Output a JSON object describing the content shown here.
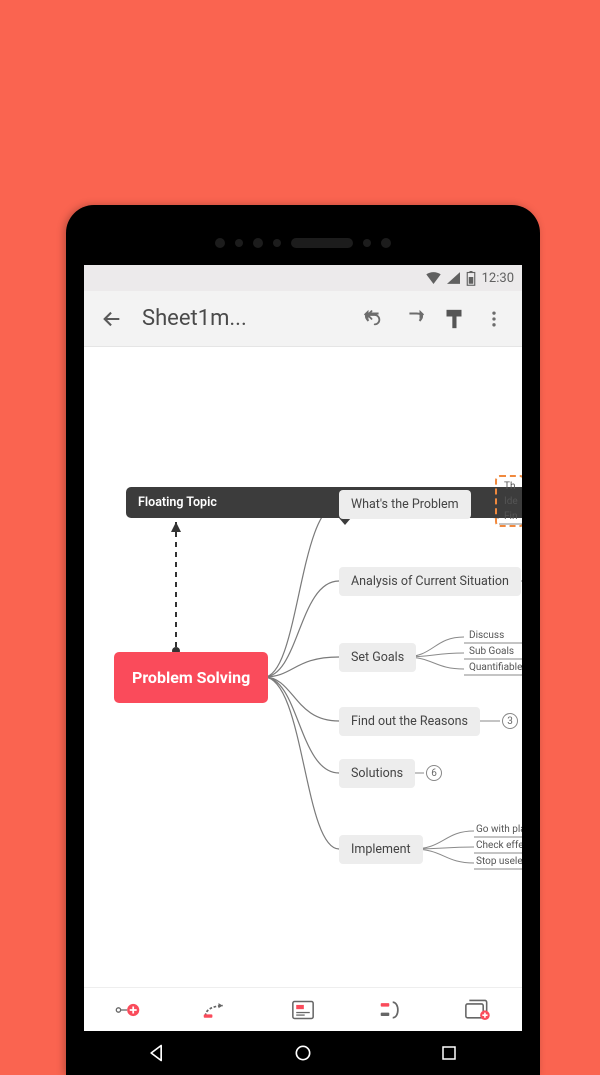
{
  "status": {
    "time": "12:30"
  },
  "toolbar": {
    "title": "Sheet1m...",
    "back": "Back",
    "undo": "Undo",
    "redo": "Redo",
    "format": "Format",
    "more": "More"
  },
  "mindmap": {
    "root": "Problem Solving",
    "floating": "Floating Topic",
    "branches": [
      {
        "label": "What's the Problem",
        "children": [
          "Th",
          "Ide",
          "Fin"
        ],
        "children_selected": true
      },
      {
        "label": "Analysis of Current Situation",
        "children": []
      },
      {
        "label": "Set Goals",
        "children": [
          "Discuss",
          "Sub Goals",
          "Quantifiable targe"
        ]
      },
      {
        "label": "Find out the Reasons",
        "collapsed_count": 3
      },
      {
        "label": "Solutions",
        "collapsed_count": 6
      },
      {
        "label": "Implement",
        "children": [
          "Go with plans",
          "Check effect of",
          "Stop useless so"
        ]
      }
    ]
  },
  "bottom": {
    "add_subtopic": "Add subtopic",
    "relationship": "Relationship",
    "notes": "Notes",
    "boundary": "Boundary",
    "add_sheet": "Add sheet"
  },
  "nav": {
    "back": "Back",
    "home": "Home",
    "recent": "Recent"
  }
}
